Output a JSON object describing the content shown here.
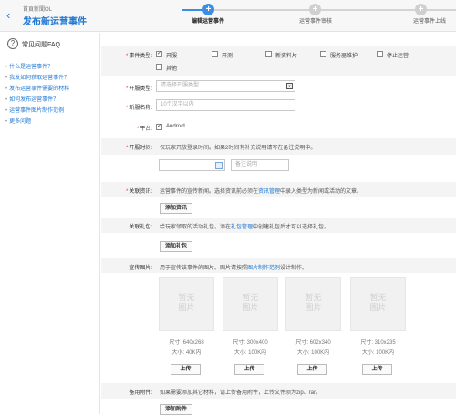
{
  "header": {
    "back_icon": "chevron-left-icon",
    "breadcrumb": "首頁新聞OL",
    "title": "发布新运营事件"
  },
  "steps": [
    {
      "label": "编辑运营事件",
      "symbol": "+",
      "active": true
    },
    {
      "label": "运营事件审核",
      "symbol": "+",
      "active": false
    },
    {
      "label": "运营事件上线",
      "symbol": "+",
      "active": false
    }
  ],
  "colors": {
    "accent": "#1f77d0",
    "step_active": "#3a8ee6",
    "step_inactive": "#cfcfcf",
    "required": "#e33333"
  },
  "sidebar": {
    "icon": "question-circle-icon",
    "title": "常见问题FAQ",
    "items": [
      "什么是运营事件？",
      "我发如何获取运营事件？",
      "发布运营事件需要的材料",
      "如何发布运营事件？",
      "运营事件图片制作范例",
      "更多问题"
    ]
  },
  "form": {
    "event_type": {
      "label": "事件类型:",
      "options": [
        {
          "label": "开服",
          "checked": true
        },
        {
          "label": "开测",
          "checked": false
        },
        {
          "label": "新资料片",
          "checked": false
        },
        {
          "label": "服务器维护",
          "checked": false
        },
        {
          "label": "停止运营",
          "checked": false
        },
        {
          "label": "其他",
          "checked": false
        }
      ]
    },
    "server_type": {
      "label": "开服类型:",
      "placeholder": "请选择开服类型"
    },
    "server_name": {
      "label": "新服名称:",
      "placeholder": "10个汉字以内"
    },
    "platform": {
      "label": "平台:",
      "option": "Android",
      "checked": true
    },
    "open_time": {
      "label": "开服时间:",
      "tip": "仅玩家开放登录时间。如果2时间有补充说明请写在备注说明中。",
      "date_value": "",
      "remark_placeholder": "备注说明"
    },
    "news": {
      "label": "关联资讯:",
      "tip_before": "运营事件的宣传新闻。选择资讯前必须在",
      "tip_link": "资讯管理",
      "tip_after": "中录入类型为新闻或活动的文章。",
      "button": "添加资讯"
    },
    "gift": {
      "label": "关联礼包:",
      "tip_before": "给玩家领取的活动礼包。添在",
      "tip_link": "礼包管理",
      "tip_after": "中创建礼包后才可以选择礼包。",
      "button": "添加礼包"
    },
    "images": {
      "label": "宣传图片:",
      "tip_before": "用于宣传该事件的图片。图片请按照",
      "tip_link": "图片制作范例",
      "tip_after": "设计制作。",
      "placeholder": "暂无\n图片",
      "upload_label": "上传",
      "items": [
        {
          "size": "尺寸: 640x268",
          "max": "大小: 40K内"
        },
        {
          "size": "尺寸: 300x400",
          "max": "大小: 100K内"
        },
        {
          "size": "尺寸: 602x340",
          "max": "大小: 100K内"
        },
        {
          "size": "尺寸: 310x235",
          "max": "大小: 100K内"
        }
      ]
    },
    "attachment": {
      "label": "备用附件:",
      "tip": "如果需要添加其它材料，请上传备用附件，上传文件须为zip、rar。",
      "button": "添加附件"
    }
  }
}
